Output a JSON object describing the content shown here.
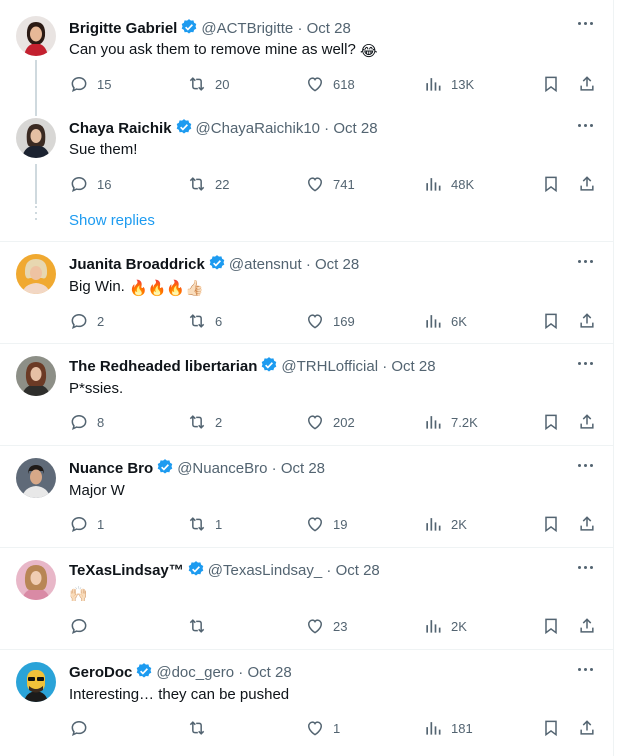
{
  "replies": [
    {
      "name": "Brigitte Gabriel",
      "handle": "@ACTBrigitte",
      "date": "Oct 28",
      "text": "Can you ask them to remove mine as well?",
      "emoji": "😂",
      "replies": "15",
      "reposts": "20",
      "likes": "618",
      "views": "13K",
      "avatar_icon": "avatar-woman-red"
    },
    {
      "name": "Chaya Raichik",
      "handle": "@ChayaRaichik10",
      "date": "Oct 28",
      "text": "Sue them!",
      "replies": "16",
      "reposts": "22",
      "likes": "741",
      "views": "48K",
      "avatar_icon": "avatar-woman-dark"
    },
    {
      "name": "Juanita Broaddrick",
      "handle": "@atensnut",
      "date": "Oct 28",
      "text": "Big Win.",
      "emoji": "🔥🔥🔥👍🏻",
      "replies": "2",
      "reposts": "6",
      "likes": "169",
      "views": "6K",
      "avatar_icon": "avatar-woman-blonde"
    },
    {
      "name": "The Redheaded libertarian",
      "handle": "@TRHLofficial",
      "date": "Oct 28",
      "text": "P*ssies.",
      "replies": "8",
      "reposts": "2",
      "likes": "202",
      "views": "7.2K",
      "avatar_icon": "avatar-woman-redhead"
    },
    {
      "name": "Nuance Bro",
      "handle": "@NuanceBro",
      "date": "Oct 28",
      "text": "Major W",
      "replies": "1",
      "reposts": "1",
      "likes": "19",
      "views": "2K",
      "avatar_icon": "avatar-man"
    },
    {
      "name": "TeXasLindsay™",
      "handle": "@TexasLindsay_",
      "date": "Oct 28",
      "text": "",
      "emoji": "🙌🏻",
      "replies": "",
      "reposts": "",
      "likes": "23",
      "views": "2K",
      "avatar_icon": "avatar-woman-pink"
    },
    {
      "name": "GeroDoc",
      "handle": "@doc_gero",
      "date": "Oct 28",
      "text": "Interesting… they can be pushed",
      "replies": "",
      "reposts": "",
      "likes": "1",
      "views": "181",
      "avatar_icon": "avatar-cartoon-man"
    }
  ],
  "show_replies_label": "Show replies",
  "colors": {
    "verified": "#1d9bf0",
    "muted": "#536471",
    "link": "#1d9bf0",
    "divider": "#eff3f4"
  }
}
